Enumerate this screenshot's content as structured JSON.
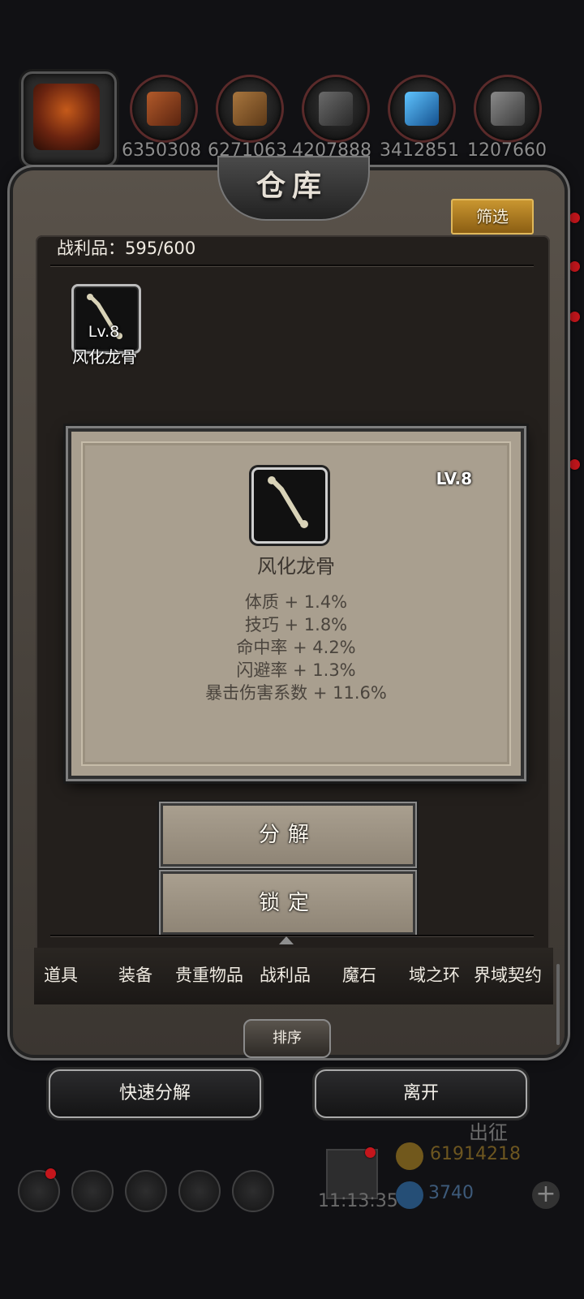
{
  "top_bar": {
    "resources": [
      {
        "icon": "pumpkin-head-avatar-icon",
        "value": ""
      },
      {
        "icon": "meat-resource-icon",
        "value": "6350308"
      },
      {
        "icon": "wood-resource-icon",
        "value": "6271063"
      },
      {
        "icon": "iron-ingot-resource-icon",
        "value": "4207888"
      },
      {
        "icon": "crystal-resource-icon",
        "value": "3412851"
      },
      {
        "icon": "steel-ingot-resource-icon",
        "value": "1207660"
      }
    ]
  },
  "warehouse": {
    "title": "仓库",
    "filter_label": "筛选",
    "count_label": "战利品：595/600",
    "items": [
      {
        "name": "风化龙骨",
        "level": "Lv.8",
        "icon": "bone-icon"
      }
    ]
  },
  "detail": {
    "level": "LV.8",
    "name": "风化龙骨",
    "stats": [
      "体质 + 1.4%",
      "技巧 + 1.8%",
      "命中率 + 4.2%",
      "闪避率 + 1.3%",
      "暴击伤害系数 + 11.6%"
    ]
  },
  "actions": {
    "decompose": "分解",
    "lock": "锁定"
  },
  "tabs": [
    "道具",
    "装备",
    "贵重物品",
    "战利品",
    "魔石",
    "域之环",
    "界域契约"
  ],
  "active_tab": "战利品",
  "sort_label": "排序",
  "bottom_buttons": {
    "quick_decompose": "快速分解",
    "leave": "离开"
  },
  "hud": {
    "expedition": "出征",
    "gold": "61914218",
    "gems": "3740",
    "time": "11:13:35"
  },
  "colors": {
    "accent_gold": "#c99630",
    "panel_parchment": "#a99f8f",
    "notification_red": "#c4161c"
  }
}
